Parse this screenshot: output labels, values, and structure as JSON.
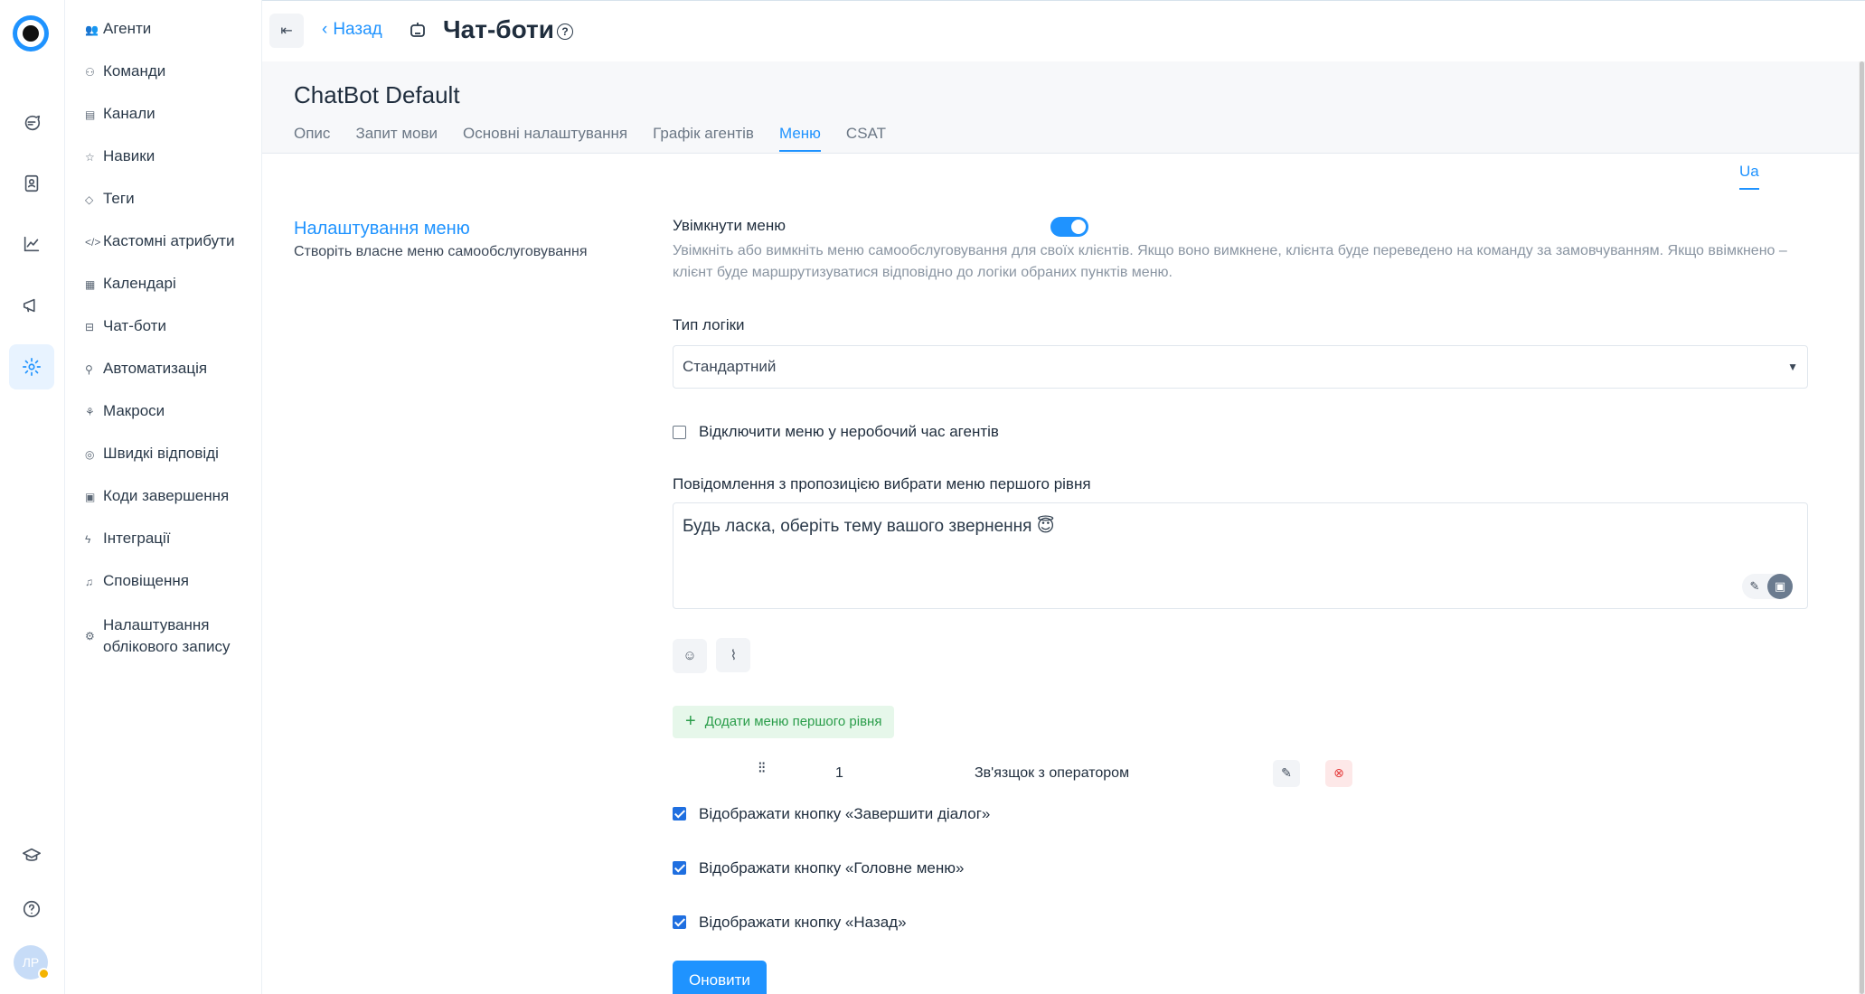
{
  "rail": {
    "items": [
      {
        "name": "conversations-icon"
      },
      {
        "name": "contacts-icon"
      },
      {
        "name": "reports-icon"
      },
      {
        "name": "campaigns-icon"
      },
      {
        "name": "settings-icon"
      }
    ],
    "avatar_initials": "ЛР"
  },
  "sidebar": {
    "items": [
      {
        "label": "Агенти"
      },
      {
        "label": "Команди"
      },
      {
        "label": "Канали"
      },
      {
        "label": "Навики"
      },
      {
        "label": "Теги"
      },
      {
        "label": "Кастомні атрибути"
      },
      {
        "label": "Календарі"
      },
      {
        "label": "Чат-боти"
      },
      {
        "label": "Автоматизація"
      },
      {
        "label": "Макроси"
      },
      {
        "label": "Швидкі відповіді"
      },
      {
        "label": "Коди завершення"
      },
      {
        "label": "Інтеграції"
      },
      {
        "label": "Сповіщення"
      },
      {
        "label": "Налаштування облікового запису"
      }
    ]
  },
  "header": {
    "back_label": "Назад",
    "title": "Чат-боти"
  },
  "bot": {
    "name": "ChatBot Default",
    "tabs": [
      {
        "label": "Опис"
      },
      {
        "label": "Запит мови"
      },
      {
        "label": "Основні налаштування"
      },
      {
        "label": "Графік агентів"
      },
      {
        "label": "Меню"
      },
      {
        "label": "CSAT"
      }
    ],
    "active_tab": "Меню"
  },
  "language_tab": "Ua",
  "section": {
    "title": "Налаштування меню",
    "subtitle": "Створіть власне меню самообслуговування"
  },
  "form": {
    "enable_menu_label": "Увімкнути меню",
    "enable_menu_hint": "Увімкніть або вимкніть меню самообслуговування для своїх клієнтів. Якщо воно вимкнене, клієнта буде переведено на команду за замовчуванням. Якщо ввімкнено – клієнт буде маршрутизуватися відповідно до логіки обраних пунктів меню.",
    "logic_type_label": "Тип логіки",
    "logic_type_value": "Стандартний",
    "disable_offhours_label": "Відключити меню у неробочий час агентів",
    "first_level_message_label": "Повідомлення з пропозицією вибрати меню першого рівня",
    "first_level_message_value": "Будь ласка, оберіть тему вашого звернення 😇",
    "add_first_level_label": "Додати меню першого рівня",
    "menu_items": [
      {
        "number": "1",
        "name": "Зв'язщок з оператором"
      }
    ],
    "show_end_dialog_label": "Відображати кнопку «Завершити діалог»",
    "show_main_menu_label": "Відображати кнопку «Головне меню»",
    "show_back_label": "Відображати кнопку «Назад»",
    "submit_label": "Оновити"
  },
  "colors": {
    "accent": "#1f93ff",
    "success": "#2a9d4a",
    "danger": "#e53e3e"
  }
}
